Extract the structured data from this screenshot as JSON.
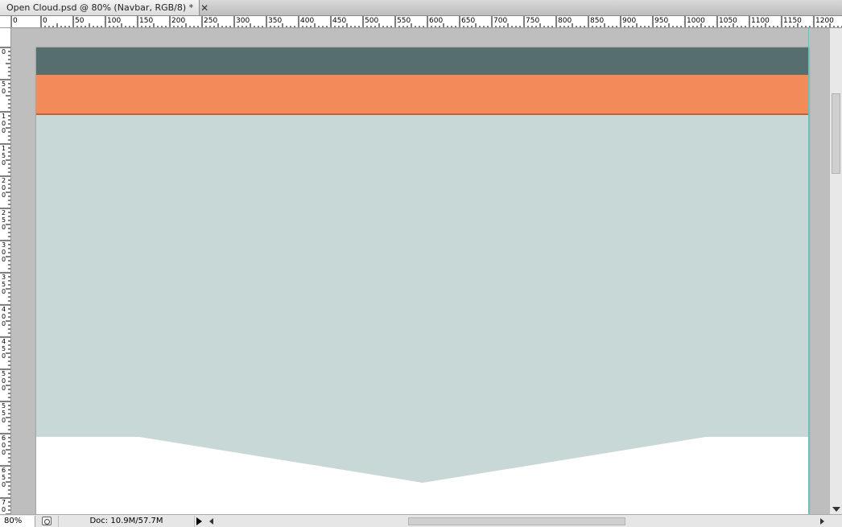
{
  "document_tab": {
    "title": "Open Cloud.psd @ 80% (Navbar, RGB/8) *",
    "close_glyph": "✕"
  },
  "ruler": {
    "horizontal_labels": [
      "0",
      "0",
      "50",
      "100",
      "150",
      "200",
      "250",
      "300",
      "350",
      "400",
      "450",
      "500",
      "550",
      "600",
      "650",
      "700",
      "750",
      "800",
      "850",
      "900",
      "950",
      "1000",
      "1050",
      "1100",
      "1150",
      "1200"
    ],
    "vertical_labels": [
      "0",
      "50",
      "100",
      "150",
      "200",
      "250",
      "300",
      "350",
      "400",
      "450",
      "500",
      "550",
      "600",
      "650",
      "700"
    ]
  },
  "artboard": {
    "colors": {
      "navbar_dark": "#566e6e",
      "navbar_orange": "#f28a5a",
      "orange_border": "#c85f34",
      "hero": "#c8d8d6",
      "guide": "#39d6cc",
      "background": "#ffffff"
    }
  },
  "statusbar": {
    "zoom": "80%",
    "doc_info": "Doc: 10.9M/57.7M",
    "icons": [
      "status-menu-icon",
      "expand-arrow-icon"
    ]
  },
  "scrollbars": {
    "icons": [
      "scroll-left-icon",
      "scroll-right-icon",
      "scroll-down-icon"
    ]
  }
}
